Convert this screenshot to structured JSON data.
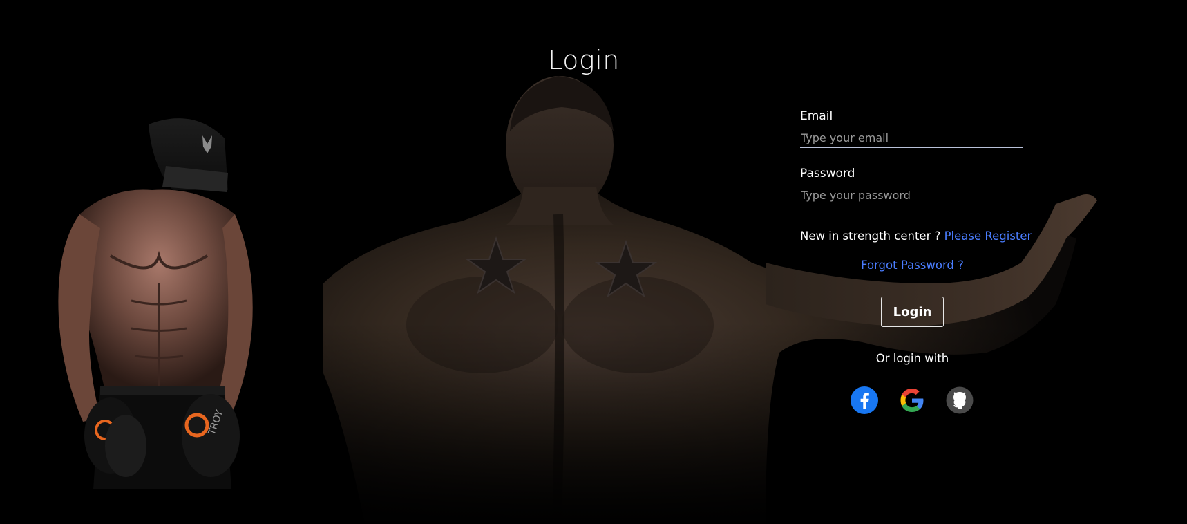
{
  "page": {
    "title": "Login"
  },
  "form": {
    "email_label": "Email",
    "email_placeholder": "Type your email",
    "email_value": "",
    "password_label": "Password",
    "password_placeholder": "Type your password",
    "password_value": "",
    "register_prompt": "New in strength center ?",
    "register_link": "Please Register",
    "forgot_link": "Forgot Password ?",
    "login_button": "Login",
    "or_login_with": "Or login with"
  },
  "social": [
    {
      "icon": "facebook-icon",
      "color": "#1877f2"
    },
    {
      "icon": "google-icon",
      "color": "#ea4335"
    },
    {
      "icon": "github-icon",
      "color": "#4a4a4a"
    }
  ],
  "colors": {
    "background": "#000000",
    "link": "#4a7dff",
    "input_underline": "#b9c1d9"
  }
}
